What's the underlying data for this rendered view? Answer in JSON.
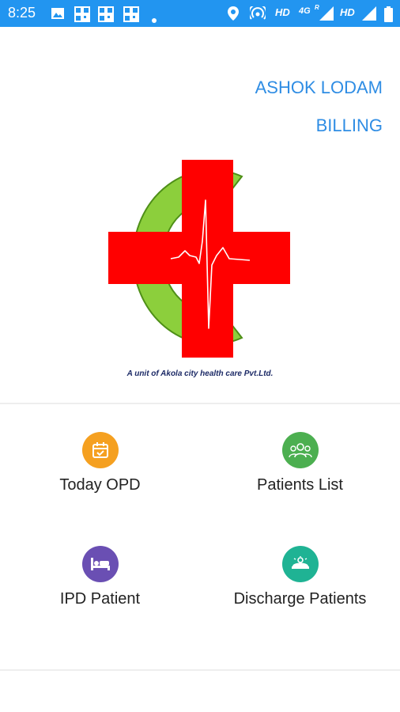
{
  "status_bar": {
    "time": "8:25",
    "network_hd1": "HD",
    "network_4g": "4G",
    "network_r": "R",
    "network_hd2": "HD",
    "icons": [
      "image-icon",
      "qr-icon",
      "qr-icon",
      "qr-icon",
      "dot-icon",
      "location-icon",
      "hotspot-icon",
      "signal-icon",
      "signal-icon",
      "battery-icon"
    ]
  },
  "header": {
    "name": "ASHOK LODAM",
    "role": "BILLING"
  },
  "logo": {
    "tagline": "A unit of Akola city health  care Pvt.Ltd.",
    "colors": {
      "green": "#8ccf3c",
      "red": "#ff0000"
    }
  },
  "menu": {
    "items": [
      {
        "label": "Today OPD",
        "icon": "calendar-icon",
        "color": "#f5a020"
      },
      {
        "label": "Patients List",
        "icon": "group-icon",
        "color": "#4caf50"
      },
      {
        "label": "IPD Patient",
        "icon": "bed-icon",
        "color": "#6a4fb3"
      },
      {
        "label": "Discharge Patients",
        "icon": "discharge-icon",
        "color": "#1fb394"
      }
    ]
  }
}
